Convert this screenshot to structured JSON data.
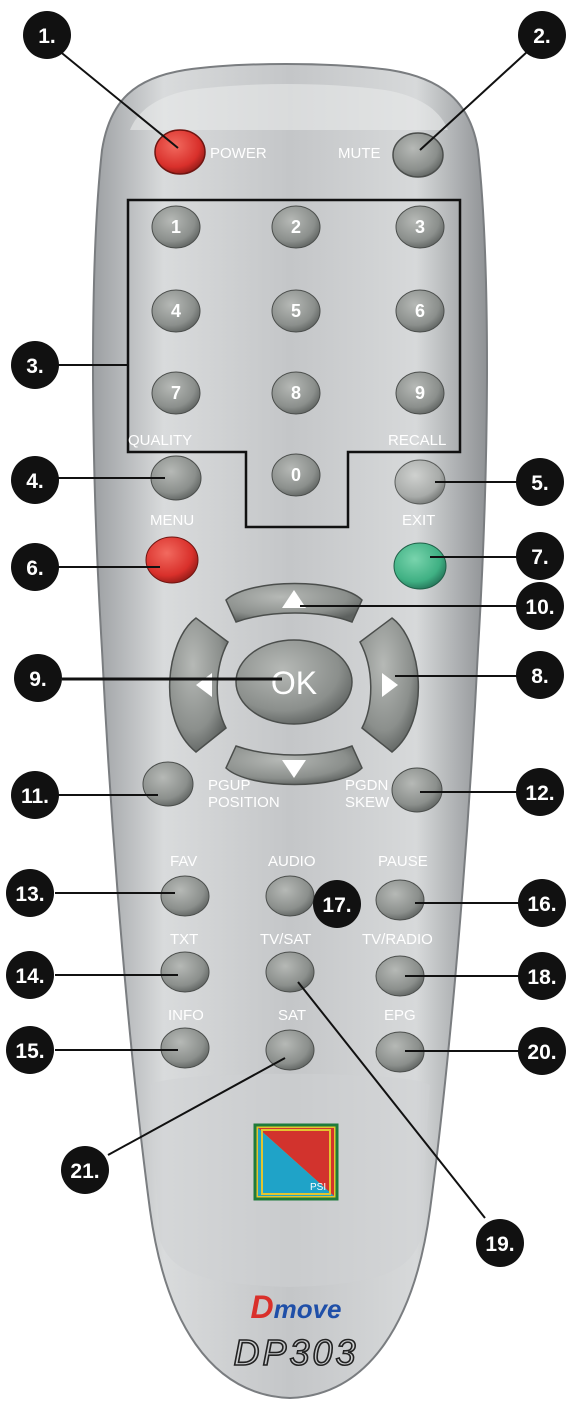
{
  "remote": {
    "labels": {
      "power": "POWER",
      "mute": "MUTE",
      "quality": "QUALITY",
      "recall": "RECALL",
      "menu": "MENU",
      "exit": "EXIT",
      "ok": "OK",
      "pgup_1": "PGUP",
      "pgup_2": "POSITION",
      "pgdn_1": "PGDN",
      "pgdn_2": "SKEW",
      "fav": "FAV",
      "audio": "AUDIO",
      "pause": "PAUSE",
      "txt": "TXT",
      "tvsat": "TV/SAT",
      "tvradio": "TV/RADIO",
      "info": "INFO",
      "sat": "SAT",
      "epg": "EPG"
    },
    "digits": [
      "1",
      "2",
      "3",
      "4",
      "5",
      "6",
      "7",
      "8",
      "9",
      "0"
    ],
    "logo_text": "PSI",
    "brand": "Dmove",
    "model": "DP303"
  },
  "callouts": [
    "1.",
    "2.",
    "3.",
    "4.",
    "5.",
    "6.",
    "7.",
    "8.",
    "9.",
    "10.",
    "11.",
    "12.",
    "13.",
    "14.",
    "15.",
    "16.",
    "17.",
    "18.",
    "19.",
    "20.",
    "21."
  ],
  "colors": {
    "power_button": "#d9302b",
    "menu_button": "#dd2f2a",
    "exit_button": "#3fb083",
    "gray_button": "#8f9390",
    "badge": "#111111"
  }
}
